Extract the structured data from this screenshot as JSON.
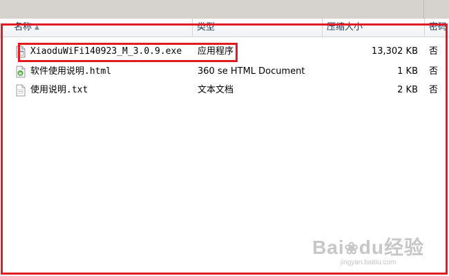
{
  "columns": {
    "name": "名称",
    "type": "类型",
    "size": "压缩大小",
    "password": "密码"
  },
  "rows": [
    {
      "name": "XiaoduWiFi140923_M_3.0.9.exe",
      "type": "应用程序",
      "size": "13,302 KB",
      "password": "否",
      "icon": "exe-file-icon"
    },
    {
      "name": "软件使用说明.html",
      "type": "360 se HTML Document",
      "size": "1 KB",
      "password": "否",
      "icon": "html-file-icon"
    },
    {
      "name": "使用说明.txt",
      "type": "文本文档",
      "size": "2 KB",
      "password": "否",
      "icon": "txt-file-icon"
    }
  ],
  "watermark": {
    "brand_a": "Bai",
    "brand_b": "du",
    "brand_c": "经验",
    "url": "jingyan.baidu.com"
  },
  "colors": {
    "highlight": "#e01b24",
    "header_text": "#1e395b"
  }
}
